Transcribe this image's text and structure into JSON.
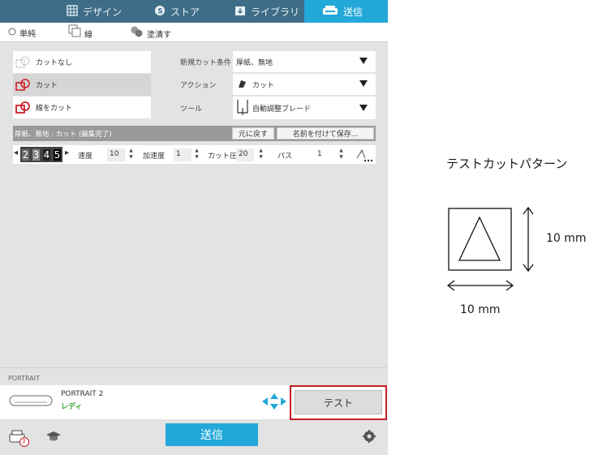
{
  "tabs": [
    {
      "label": "デザイン",
      "icon": "grid-icon"
    },
    {
      "label": "ストア",
      "icon": "store-icon"
    },
    {
      "label": "ライブラリ",
      "icon": "library-icon"
    },
    {
      "label": "送信",
      "icon": "send-icon"
    }
  ],
  "modes": [
    {
      "label": "単純",
      "icon": "radio-icon"
    },
    {
      "label": "線",
      "icon": "line-icon"
    },
    {
      "label": "塗潰す",
      "icon": "fill-icon"
    }
  ],
  "cut_options": [
    "カットなし",
    "カット",
    "線をカット"
  ],
  "settings": {
    "material_label": "新規カット条件",
    "material_value": "厚紙、無地",
    "action_label": "アクション",
    "action_value": "カット",
    "tool_label": "ツール",
    "tool_value": "自動調整ブレード"
  },
  "status": {
    "text": "厚紙、無地 : カット (編集完了)",
    "revert_label": "元に戻す",
    "save_as_label": "名前を付けて保存..."
  },
  "params": {
    "blade_digits": [
      "2",
      "3",
      "4",
      "5"
    ],
    "speed_label": "速度",
    "speed_value": "10",
    "accel_label": "加速度",
    "accel_value": "1",
    "force_label": "カット圧",
    "force_value": "20",
    "pass_label": "パス",
    "pass_value": "1"
  },
  "device": {
    "section_label": "PORTRAIT",
    "name": "PORTRAIT 2",
    "status": "レディ",
    "test_label": "テスト"
  },
  "bottom": {
    "send_label": "送信",
    "badge": "3"
  },
  "annotation": {
    "title": "テストカットパターン",
    "height_label": "10 mm",
    "width_label": "10 mm"
  },
  "colors": {
    "tabbar": "#3f6d87",
    "accent": "#23a9d9",
    "cut_red": "#d0202a",
    "highlight": "#c6202b",
    "ready_green": "#3aa534"
  }
}
